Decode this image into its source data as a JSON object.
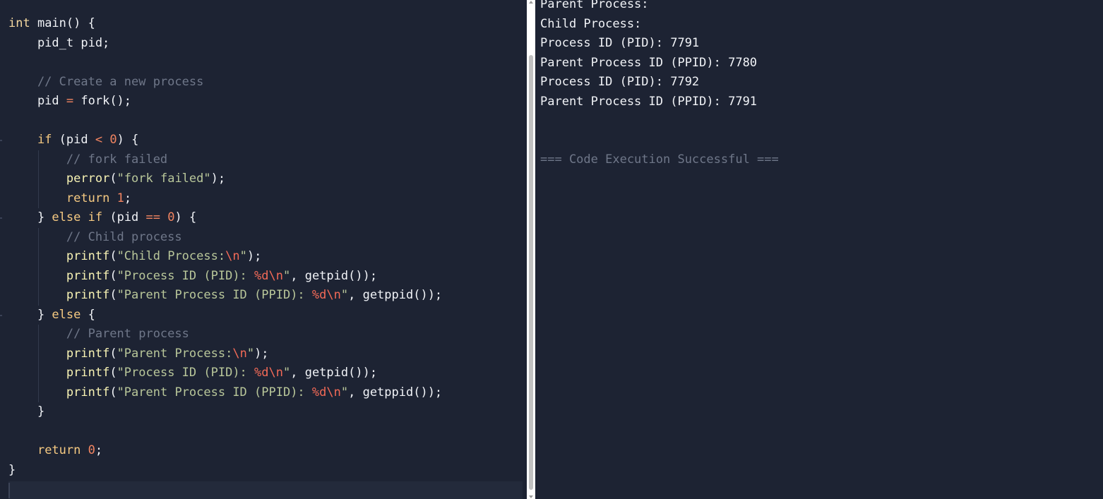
{
  "editor": {
    "lines": [
      [
        {
          "t": "int",
          "c": "kw"
        },
        {
          "t": " main() {",
          "c": "pl"
        }
      ],
      [
        {
          "t": "    pid_t pid;",
          "c": "pl"
        }
      ],
      [],
      [
        {
          "t": "    // Create a new process",
          "c": "cm"
        }
      ],
      [
        {
          "t": "    pid ",
          "c": "pl"
        },
        {
          "t": "=",
          "c": "op"
        },
        {
          "t": " fork();",
          "c": "pl"
        }
      ],
      [],
      [
        {
          "t": "    ",
          "c": "pl"
        },
        {
          "t": "if",
          "c": "kw2"
        },
        {
          "t": " (pid ",
          "c": "pl"
        },
        {
          "t": "<",
          "c": "op"
        },
        {
          "t": " ",
          "c": "pl"
        },
        {
          "t": "0",
          "c": "num"
        },
        {
          "t": ") {",
          "c": "pl"
        }
      ],
      [
        {
          "t": "        // fork failed",
          "c": "cm"
        }
      ],
      [
        {
          "t": "        ",
          "c": "pl"
        },
        {
          "t": "perror",
          "c": "fn"
        },
        {
          "t": "(",
          "c": "pl"
        },
        {
          "t": "\"fork failed\"",
          "c": "str"
        },
        {
          "t": ");",
          "c": "pl"
        }
      ],
      [
        {
          "t": "        ",
          "c": "pl"
        },
        {
          "t": "return",
          "c": "kw2"
        },
        {
          "t": " ",
          "c": "pl"
        },
        {
          "t": "1",
          "c": "num"
        },
        {
          "t": ";",
          "c": "pl"
        }
      ],
      [
        {
          "t": "    } ",
          "c": "pl"
        },
        {
          "t": "else",
          "c": "kw2"
        },
        {
          "t": " ",
          "c": "pl"
        },
        {
          "t": "if",
          "c": "kw2"
        },
        {
          "t": " (pid ",
          "c": "pl"
        },
        {
          "t": "==",
          "c": "op"
        },
        {
          "t": " ",
          "c": "pl"
        },
        {
          "t": "0",
          "c": "num"
        },
        {
          "t": ") {",
          "c": "pl"
        }
      ],
      [
        {
          "t": "        // Child process",
          "c": "cm"
        }
      ],
      [
        {
          "t": "        ",
          "c": "pl"
        },
        {
          "t": "printf",
          "c": "fn"
        },
        {
          "t": "(",
          "c": "pl"
        },
        {
          "t": "\"Child Process:",
          "c": "str"
        },
        {
          "t": "\\n",
          "c": "esc"
        },
        {
          "t": "\"",
          "c": "str"
        },
        {
          "t": ");",
          "c": "pl"
        }
      ],
      [
        {
          "t": "        ",
          "c": "pl"
        },
        {
          "t": "printf",
          "c": "fn"
        },
        {
          "t": "(",
          "c": "pl"
        },
        {
          "t": "\"Process ID (PID): ",
          "c": "str"
        },
        {
          "t": "%d\\n",
          "c": "esc"
        },
        {
          "t": "\"",
          "c": "str"
        },
        {
          "t": ", getpid());",
          "c": "pl"
        }
      ],
      [
        {
          "t": "        ",
          "c": "pl"
        },
        {
          "t": "printf",
          "c": "fn"
        },
        {
          "t": "(",
          "c": "pl"
        },
        {
          "t": "\"Parent Process ID (PPID): ",
          "c": "str"
        },
        {
          "t": "%d\\n",
          "c": "esc"
        },
        {
          "t": "\"",
          "c": "str"
        },
        {
          "t": ", getppid());",
          "c": "pl"
        }
      ],
      [
        {
          "t": "    } ",
          "c": "pl"
        },
        {
          "t": "else",
          "c": "kw2"
        },
        {
          "t": " {",
          "c": "pl"
        }
      ],
      [
        {
          "t": "        // Parent process",
          "c": "cm"
        }
      ],
      [
        {
          "t": "        ",
          "c": "pl"
        },
        {
          "t": "printf",
          "c": "fn"
        },
        {
          "t": "(",
          "c": "pl"
        },
        {
          "t": "\"Parent Process:",
          "c": "str"
        },
        {
          "t": "\\n",
          "c": "esc"
        },
        {
          "t": "\"",
          "c": "str"
        },
        {
          "t": ");",
          "c": "pl"
        }
      ],
      [
        {
          "t": "        ",
          "c": "pl"
        },
        {
          "t": "printf",
          "c": "fn"
        },
        {
          "t": "(",
          "c": "pl"
        },
        {
          "t": "\"Process ID (PID): ",
          "c": "str"
        },
        {
          "t": "%d\\n",
          "c": "esc"
        },
        {
          "t": "\"",
          "c": "str"
        },
        {
          "t": ", getpid());",
          "c": "pl"
        }
      ],
      [
        {
          "t": "        ",
          "c": "pl"
        },
        {
          "t": "printf",
          "c": "fn"
        },
        {
          "t": "(",
          "c": "pl"
        },
        {
          "t": "\"Parent Process ID (PPID): ",
          "c": "str"
        },
        {
          "t": "%d\\n",
          "c": "esc"
        },
        {
          "t": "\"",
          "c": "str"
        },
        {
          "t": ", getppid());",
          "c": "pl"
        }
      ],
      [
        {
          "t": "    }",
          "c": "pl"
        }
      ],
      [],
      [
        {
          "t": "    ",
          "c": "pl"
        },
        {
          "t": "return",
          "c": "kw2"
        },
        {
          "t": " ",
          "c": "pl"
        },
        {
          "t": "0",
          "c": "num"
        },
        {
          "t": ";",
          "c": "pl"
        }
      ],
      [
        {
          "t": "}",
          "c": "pl"
        }
      ]
    ]
  },
  "output": {
    "lines": [
      "Parent Process:",
      "Child Process:",
      "Process ID (PID): 7791",
      "Parent Process ID (PPID): 7780",
      "Process ID (PID): 7792",
      "Parent Process ID (PPID): 7791",
      "",
      "",
      "=== Code Execution Successful ==="
    ]
  },
  "colors": {
    "background": "#1d2333",
    "comment": "#6f7789",
    "string": "#b9c79a",
    "number": "#f38561",
    "function": "#f8f3b4",
    "keyword": "#f6ca82"
  }
}
